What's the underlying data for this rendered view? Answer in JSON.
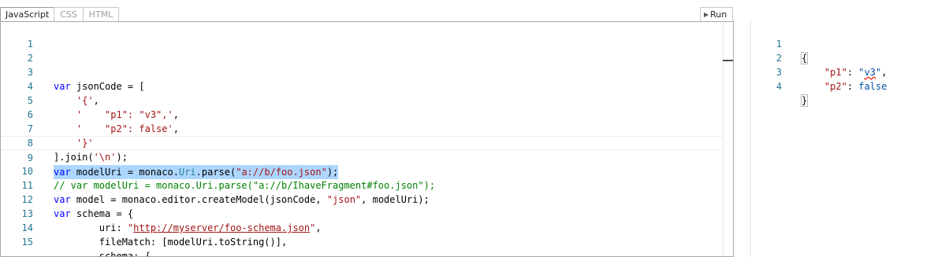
{
  "tabs": [
    {
      "label": "JavaScript",
      "active": true
    },
    {
      "label": "CSS",
      "active": false
    },
    {
      "label": "HTML",
      "active": false
    }
  ],
  "run_label": "Run",
  "editor": {
    "lines": [
      {
        "n": "1",
        "text": ""
      },
      {
        "n": "2",
        "text": ""
      },
      {
        "n": "3",
        "text": "var jsonCode = ["
      },
      {
        "n": "4",
        "text": "    '{',"
      },
      {
        "n": "5",
        "text": "    '    \"p1\": \"v3\",',"
      },
      {
        "n": "6",
        "text": "    '    \"p2\": false',"
      },
      {
        "n": "7",
        "text": "    '}'"
      },
      {
        "n": "8",
        "text": "].join('\\n');"
      },
      {
        "n": "9",
        "text": "var modelUri = monaco.Uri.parse(\"a://b/foo.json\");"
      },
      {
        "n": "10",
        "text": "// var modelUri = monaco.Uri.parse(\"a://b/IhaveFragment#foo.json\");"
      },
      {
        "n": "11",
        "text": "var model = monaco.editor.createModel(jsonCode, \"json\", modelUri);"
      },
      {
        "n": "12",
        "text": "var schema = {"
      },
      {
        "n": "13",
        "text": "        uri: \"http://myserver/foo-schema.json\","
      },
      {
        "n": "14",
        "text": "        fileMatch: [modelUri.toString()],"
      },
      {
        "n": "15",
        "text": "        schema: {"
      }
    ]
  },
  "json_editor": {
    "lines": [
      {
        "n": "1",
        "text": "{"
      },
      {
        "n": "2",
        "text": "    \"p1\": \"v3\","
      },
      {
        "n": "3",
        "text": "    \"p2\": false"
      },
      {
        "n": "4",
        "text": "}"
      }
    ]
  },
  "colors": {
    "keyword": "#0000ff",
    "string": "#a31515",
    "comment": "#008000",
    "type": "#267f99",
    "line_number": "#237893",
    "selection": "#add6ff"
  }
}
